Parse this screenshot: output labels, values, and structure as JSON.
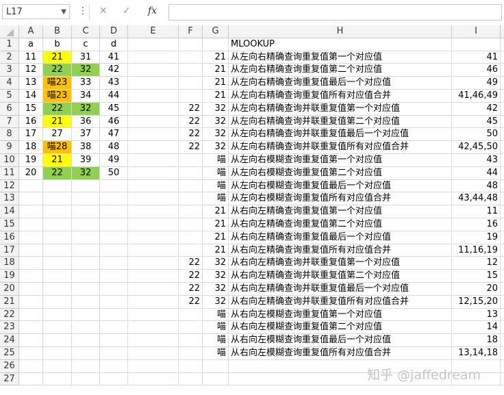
{
  "name_box": "L17",
  "formula_value": "",
  "toolbar_icons": {
    "more": "⋮",
    "cancel": "✕",
    "enter": "✓",
    "fx": "fx"
  },
  "columns": [
    "A",
    "B",
    "C",
    "D",
    "E",
    "F",
    "G",
    "H",
    "I"
  ],
  "row_numbers": [
    "1",
    "2",
    "3",
    "4",
    "5",
    "6",
    "7",
    "8",
    "9",
    "10",
    "11",
    "12",
    "13",
    "14",
    "15",
    "16",
    "17",
    "18",
    "19",
    "20",
    "21",
    "22",
    "23",
    "24",
    "25",
    "26",
    "27"
  ],
  "rows": [
    {
      "A": "a",
      "B": "b",
      "C": "c",
      "D": "d",
      "E": "",
      "F": "",
      "G": "",
      "H": "MLOOKUP",
      "I": ""
    },
    {
      "A": "11",
      "B": "21",
      "C": "31",
      "D": "41",
      "E": "",
      "F": "",
      "G": "21",
      "H": "从左向右精确查询重复值第一个对应值",
      "I": "41"
    },
    {
      "A": "12",
      "B": "22",
      "C": "32",
      "D": "42",
      "E": "",
      "F": "",
      "G": "21",
      "H": "从左向右精确查询重复值第二个对应值",
      "I": "46"
    },
    {
      "A": "13",
      "B": "喵23",
      "C": "33",
      "D": "43",
      "E": "",
      "F": "",
      "G": "21",
      "H": "从左向右精确查询重复值最后一个对应值",
      "I": "49"
    },
    {
      "A": "14",
      "B": "喵23",
      "C": "34",
      "D": "44",
      "E": "",
      "F": "",
      "G": "21",
      "H": "从左向右精确查询重复值所有对应值合并",
      "I": "41,46,49"
    },
    {
      "A": "15",
      "B": "22",
      "C": "32",
      "D": "45",
      "E": "",
      "F": "22",
      "G": "32",
      "H": "从左向右精确查询并联重复值第一个对应值",
      "I": "42"
    },
    {
      "A": "16",
      "B": "21",
      "C": "36",
      "D": "46",
      "E": "",
      "F": "22",
      "G": "32",
      "H": "从左向右精确查询并联重复值第二个对应值",
      "I": "45"
    },
    {
      "A": "17",
      "B": "27",
      "C": "37",
      "D": "47",
      "E": "",
      "F": "22",
      "G": "32",
      "H": "从左向右精确查询并联重复值最后一个对应值",
      "I": "50"
    },
    {
      "A": "18",
      "B": "喵28",
      "C": "38",
      "D": "48",
      "E": "",
      "F": "22",
      "G": "32",
      "H": "从左向右精确查询并联重复值所有对应值合并",
      "I": "42,45,50"
    },
    {
      "A": "19",
      "B": "21",
      "C": "39",
      "D": "49",
      "E": "",
      "F": "",
      "G": "喵",
      "H": "从左向右模糊查询重复值第一个对应值",
      "I": "43"
    },
    {
      "A": "20",
      "B": "22",
      "C": "32",
      "D": "50",
      "E": "",
      "F": "",
      "G": "喵",
      "H": "从左向右模糊查询重复值第二个对应值",
      "I": "44"
    },
    {
      "A": "",
      "B": "",
      "C": "",
      "D": "",
      "E": "",
      "F": "",
      "G": "喵",
      "H": "从左向右模糊查询重复值最后一个对应值",
      "I": "48"
    },
    {
      "A": "",
      "B": "",
      "C": "",
      "D": "",
      "E": "",
      "F": "",
      "G": "喵",
      "H": "从左向右模糊查询重复值所有对应值合并",
      "I": "43,44,48"
    },
    {
      "A": "",
      "B": "",
      "C": "",
      "D": "",
      "E": "",
      "F": "",
      "G": "21",
      "H": "从右向左精确查询重复值第一个对应值",
      "I": "11"
    },
    {
      "A": "",
      "B": "",
      "C": "",
      "D": "",
      "E": "",
      "F": "",
      "G": "21",
      "H": "从右向左精确查询重复值第二个对应值",
      "I": "16"
    },
    {
      "A": "",
      "B": "",
      "C": "",
      "D": "",
      "E": "",
      "F": "",
      "G": "21",
      "H": "从右向左精确查询重复值最后一个对应值",
      "I": "19"
    },
    {
      "A": "",
      "B": "",
      "C": "",
      "D": "",
      "E": "",
      "F": "",
      "G": "21",
      "H": "从右向左精确查询重复值所有对应值合并",
      "I": "11,16,19"
    },
    {
      "A": "",
      "B": "",
      "C": "",
      "D": "",
      "E": "",
      "F": "22",
      "G": "32",
      "H": "从右向左精确查询并联重复值第一个对应值",
      "I": "12"
    },
    {
      "A": "",
      "B": "",
      "C": "",
      "D": "",
      "E": "",
      "F": "22",
      "G": "32",
      "H": "从右向左精确查询并联重复值第二个对应值",
      "I": "15"
    },
    {
      "A": "",
      "B": "",
      "C": "",
      "D": "",
      "E": "",
      "F": "22",
      "G": "32",
      "H": "从右向左精确查询并联重复值最后一个对应值",
      "I": "20"
    },
    {
      "A": "",
      "B": "",
      "C": "",
      "D": "",
      "E": "",
      "F": "22",
      "G": "32",
      "H": "从右向左精确查询并联重复值所有对应值合并",
      "I": "12,15,20"
    },
    {
      "A": "",
      "B": "",
      "C": "",
      "D": "",
      "E": "",
      "F": "",
      "G": "喵",
      "H": "从右向左模糊查询重复值第一个对应值",
      "I": "13"
    },
    {
      "A": "",
      "B": "",
      "C": "",
      "D": "",
      "E": "",
      "F": "",
      "G": "喵",
      "H": "从右向左模糊查询重复值第二个对应值",
      "I": "14"
    },
    {
      "A": "",
      "B": "",
      "C": "",
      "D": "",
      "E": "",
      "F": "",
      "G": "喵",
      "H": "从右向左模糊查询重复值最后一个对应值",
      "I": "18"
    },
    {
      "A": "",
      "B": "",
      "C": "",
      "D": "",
      "E": "",
      "F": "",
      "G": "喵",
      "H": "从右向左模糊查询重复值所有对应值合并",
      "I": "13,14,18"
    },
    {
      "A": "",
      "B": "",
      "C": "",
      "D": "",
      "E": "",
      "F": "",
      "G": "",
      "H": "",
      "I": ""
    },
    {
      "A": "",
      "B": "",
      "C": "",
      "D": "",
      "E": "",
      "F": "",
      "G": "",
      "H": "",
      "I": ""
    }
  ],
  "fills": {
    "yellow": "#ffff00",
    "green": "#92d050",
    "orange": "#ffc000"
  },
  "watermark": "知乎 @jaffedream"
}
